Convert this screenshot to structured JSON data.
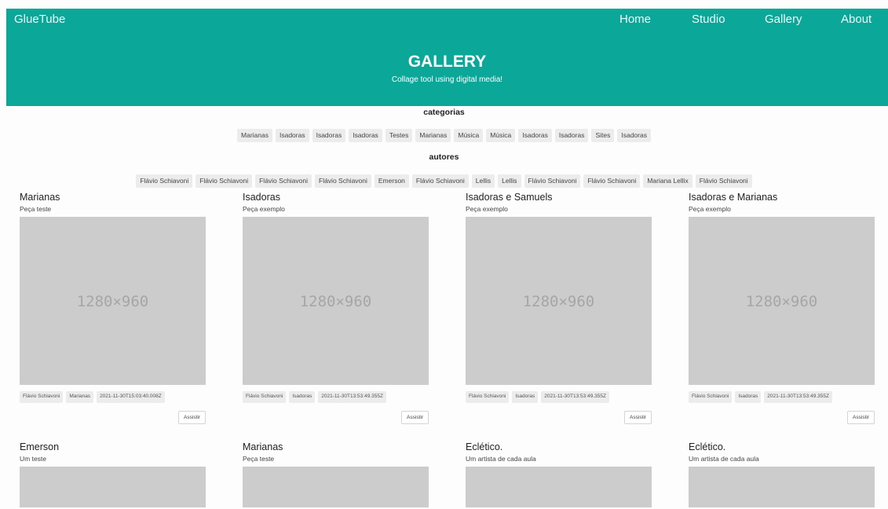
{
  "header": {
    "brand": "GlueTube",
    "nav": [
      "Home",
      "Studio",
      "Gallery",
      "About"
    ],
    "title": "GALLERY",
    "subtitle": "Collage tool using digital media!"
  },
  "categories": {
    "title": "categorias",
    "items": [
      "Marianas",
      "Isadoras",
      "Isadoras",
      "Isadoras",
      "Testes",
      "Marianas",
      "Música",
      "Música",
      "Isadoras",
      "Isadoras",
      "Sites",
      "Isadoras"
    ]
  },
  "authors": {
    "title": "autores",
    "items": [
      "Flávio Schiavoni",
      "Flávio Schiavoni",
      "Flávio Schiavoni",
      "Flávio Schiavoni",
      "Emerson",
      "Flávio Schiavoni",
      "Lellis",
      "Lellis",
      "Flávio Schiavoni",
      "Flávio Schiavoni",
      "Mariana Lellix",
      "Flávio Schiavoni"
    ]
  },
  "cards": [
    {
      "title": "Marianas",
      "subtitle": "Peça teste",
      "thumb": "1280×960",
      "tags": [
        "Flávio Schiavoni",
        "Marianas",
        "2021-11-30T15:03:40.008Z"
      ],
      "button": "Assistir"
    },
    {
      "title": "Isadoras",
      "subtitle": "Peça exemplo",
      "thumb": "1280×960",
      "tags": [
        "Flávio Schiavoni",
        "Isadoras",
        "2021-11-30T13:53:49.355Z"
      ],
      "button": "Assistir"
    },
    {
      "title": "Isadoras e Samuels",
      "subtitle": "Peça exemplo",
      "thumb": "1280×960",
      "tags": [
        "Flávio Schiavoni",
        "Isadoras",
        "2021-11-30T13:53:49.355Z"
      ],
      "button": "Assistir"
    },
    {
      "title": "Isadoras e Marianas",
      "subtitle": "Peça exemplo",
      "thumb": "1280×960",
      "tags": [
        "Flávio Schiavoni",
        "Isadoras",
        "2021-11-30T13:53:49.355Z"
      ],
      "button": "Assistir"
    },
    {
      "title": "Emerson",
      "subtitle": "Um teste"
    },
    {
      "title": "Marianas",
      "subtitle": "Peça teste"
    },
    {
      "title": "Eclético.",
      "subtitle": "Um artista de cada aula"
    },
    {
      "title": "Eclético.",
      "subtitle": "Um artista de cada aula"
    }
  ]
}
